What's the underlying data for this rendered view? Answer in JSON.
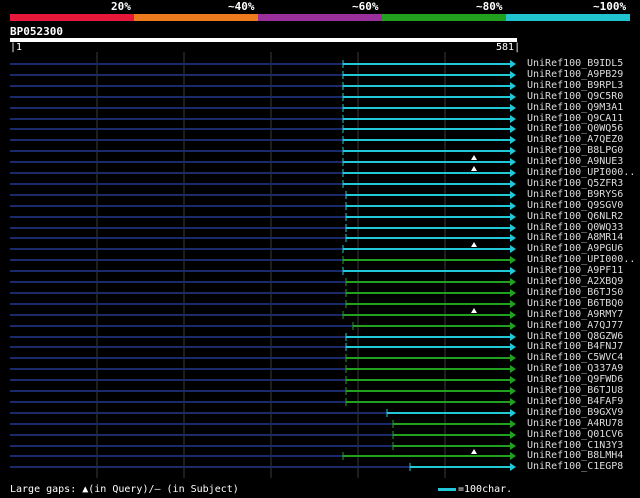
{
  "scale": {
    "labels": [
      "20%",
      "~40%",
      "~60%",
      "~80%",
      "~100%"
    ],
    "colors": [
      "#e8183a",
      "#ee7a1e",
      "#9b2f9b",
      "#22a020",
      "#20c4d0"
    ]
  },
  "query": {
    "name": "BP052300",
    "start": "1",
    "end": "581"
  },
  "colors": {
    "cyan": "#20c8d8",
    "green": "#22a020",
    "navy": "#1a2a6a",
    "grid": "#3a3a3a"
  },
  "hits": [
    {
      "name": "UniRef100_B9IDL5",
      "color": "cyan",
      "start": 343,
      "gap": false
    },
    {
      "name": "UniRef100_A9PB29",
      "color": "cyan",
      "start": 343,
      "gap": false
    },
    {
      "name": "UniRef100_B9RPL3",
      "color": "cyan",
      "start": 343,
      "gap": false
    },
    {
      "name": "UniRef100_Q9C5R0",
      "color": "cyan",
      "start": 343,
      "gap": false
    },
    {
      "name": "UniRef100_Q9M3A1",
      "color": "cyan",
      "start": 343,
      "gap": false
    },
    {
      "name": "UniRef100_Q9CA11",
      "color": "cyan",
      "start": 343,
      "gap": false
    },
    {
      "name": "UniRef100_Q0WQ56",
      "color": "cyan",
      "start": 343,
      "gap": false
    },
    {
      "name": "UniRef100_A7QEZ0",
      "color": "cyan",
      "start": 343,
      "gap": false
    },
    {
      "name": "UniRef100_B8LPG0",
      "color": "cyan",
      "start": 343,
      "gap": false
    },
    {
      "name": "UniRef100_A9NUE3",
      "color": "cyan",
      "start": 343,
      "gap": true
    },
    {
      "name": "UniRef100_UPI000..",
      "color": "cyan",
      "start": 343,
      "gap": true
    },
    {
      "name": "UniRef100_Q5ZFR3",
      "color": "cyan",
      "start": 343,
      "gap": false
    },
    {
      "name": "UniRef100_B9RYS6",
      "color": "cyan",
      "start": 346,
      "gap": false
    },
    {
      "name": "UniRef100_Q9SGV0",
      "color": "cyan",
      "start": 346,
      "gap": false
    },
    {
      "name": "UniRef100_Q6NLR2",
      "color": "cyan",
      "start": 346,
      "gap": false
    },
    {
      "name": "UniRef100_Q0WQ33",
      "color": "cyan",
      "start": 346,
      "gap": false
    },
    {
      "name": "UniRef100_A8MR14",
      "color": "cyan",
      "start": 346,
      "gap": false
    },
    {
      "name": "UniRef100_A9PGU6",
      "color": "cyan",
      "start": 343,
      "gap": true
    },
    {
      "name": "UniRef100_UPI000..",
      "color": "green",
      "start": 343,
      "gap": false
    },
    {
      "name": "UniRef100_A9PF11",
      "color": "cyan",
      "start": 343,
      "gap": false
    },
    {
      "name": "UniRef100_A2XBQ9",
      "color": "green",
      "start": 346,
      "gap": false
    },
    {
      "name": "UniRef100_B6TJS0",
      "color": "green",
      "start": 346,
      "gap": false
    },
    {
      "name": "UniRef100_B6TBQ0",
      "color": "green",
      "start": 346,
      "gap": false
    },
    {
      "name": "UniRef100_A9RMY7",
      "color": "green",
      "start": 343,
      "gap": true
    },
    {
      "name": "UniRef100_A7QJ77",
      "color": "green",
      "start": 353,
      "gap": false
    },
    {
      "name": "UniRef100_Q8GZW6",
      "color": "cyan",
      "start": 346,
      "gap": false
    },
    {
      "name": "UniRef100_B4FNJ7",
      "color": "cyan",
      "start": 346,
      "gap": false
    },
    {
      "name": "UniRef100_C5WVC4",
      "color": "green",
      "start": 346,
      "gap": false
    },
    {
      "name": "UniRef100_Q337A9",
      "color": "green",
      "start": 346,
      "gap": false
    },
    {
      "name": "UniRef100_Q9FWD6",
      "color": "green",
      "start": 346,
      "gap": false
    },
    {
      "name": "UniRef100_B6TJU8",
      "color": "green",
      "start": 346,
      "gap": false
    },
    {
      "name": "UniRef100_B4FAF9",
      "color": "green",
      "start": 346,
      "gap": false
    },
    {
      "name": "UniRef100_B9GXV9",
      "color": "cyan",
      "start": 387,
      "gap": false
    },
    {
      "name": "UniRef100_A4RU78",
      "color": "green",
      "start": 393,
      "gap": false
    },
    {
      "name": "UniRef100_Q01CV6",
      "color": "green",
      "start": 393,
      "gap": false
    },
    {
      "name": "UniRef100_C1N3Y3",
      "color": "green",
      "start": 393,
      "gap": false
    },
    {
      "name": "UniRef100_B8LMH4",
      "color": "green",
      "start": 343,
      "gap": true
    },
    {
      "name": "UniRef100_C1EGP8",
      "color": "cyan",
      "start": 410,
      "gap": false
    }
  ],
  "legend": {
    "text": "Large gaps: ▲(in Query)/– (in Subject)",
    "scale": "=100char."
  }
}
